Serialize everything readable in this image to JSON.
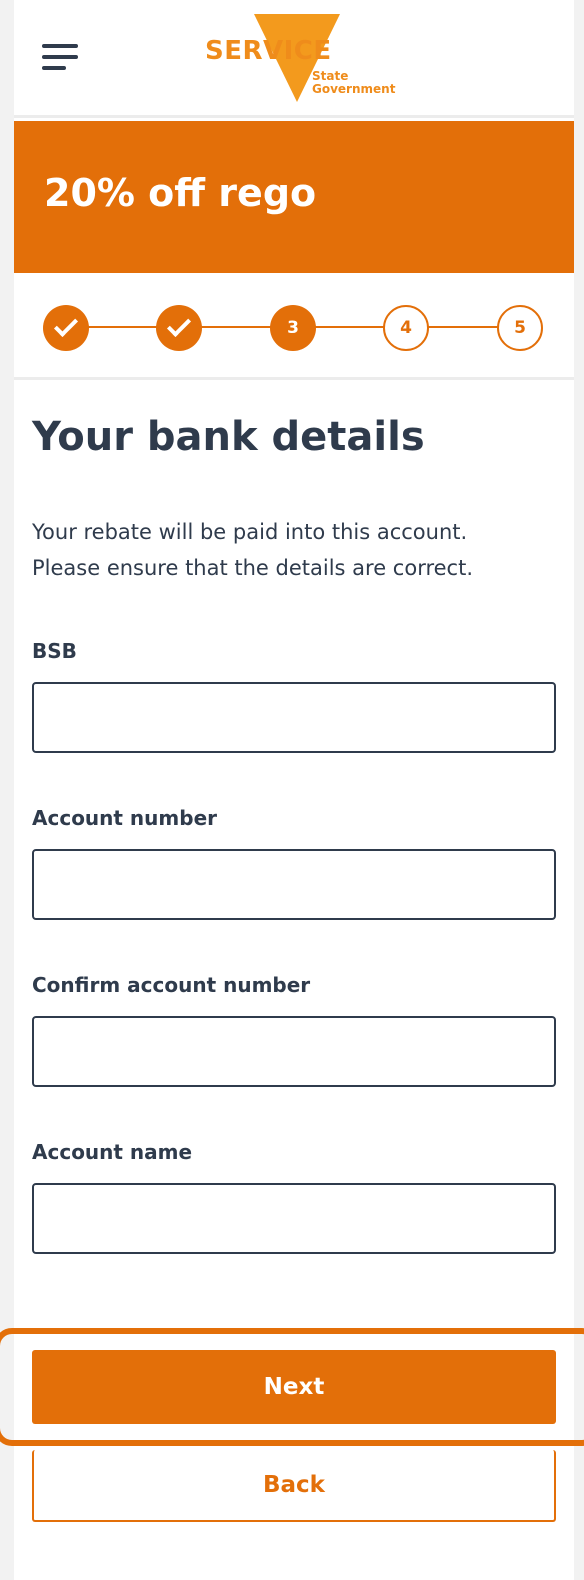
{
  "header": {
    "menu_icon": "hamburger-menu-icon",
    "logo": {
      "word": "SERVICE",
      "sub_line1": "State",
      "sub_line2": "Government"
    }
  },
  "banner": {
    "title": "20% off rego"
  },
  "stepper": {
    "steps": [
      {
        "label": "",
        "state": "done"
      },
      {
        "label": "",
        "state": "done"
      },
      {
        "label": "3",
        "state": "current"
      },
      {
        "label": "4",
        "state": "todo"
      },
      {
        "label": "5",
        "state": "todo"
      }
    ]
  },
  "main": {
    "title": "Your bank details",
    "intro_line1": "Your rebate will be paid into this account.",
    "intro_line2": "Please ensure that the details are correct.",
    "fields": {
      "bsb": {
        "label": "BSB",
        "value": ""
      },
      "account_number": {
        "label": "Account number",
        "value": ""
      },
      "confirm_account_number": {
        "label": "Confirm account number",
        "value": ""
      },
      "account_name": {
        "label": "Account name",
        "value": ""
      }
    }
  },
  "actions": {
    "next_label": "Next",
    "back_label": "Back"
  },
  "colors": {
    "accent": "#e36f09",
    "text": "#2f3b4c",
    "logo": "#ef8c1b"
  }
}
